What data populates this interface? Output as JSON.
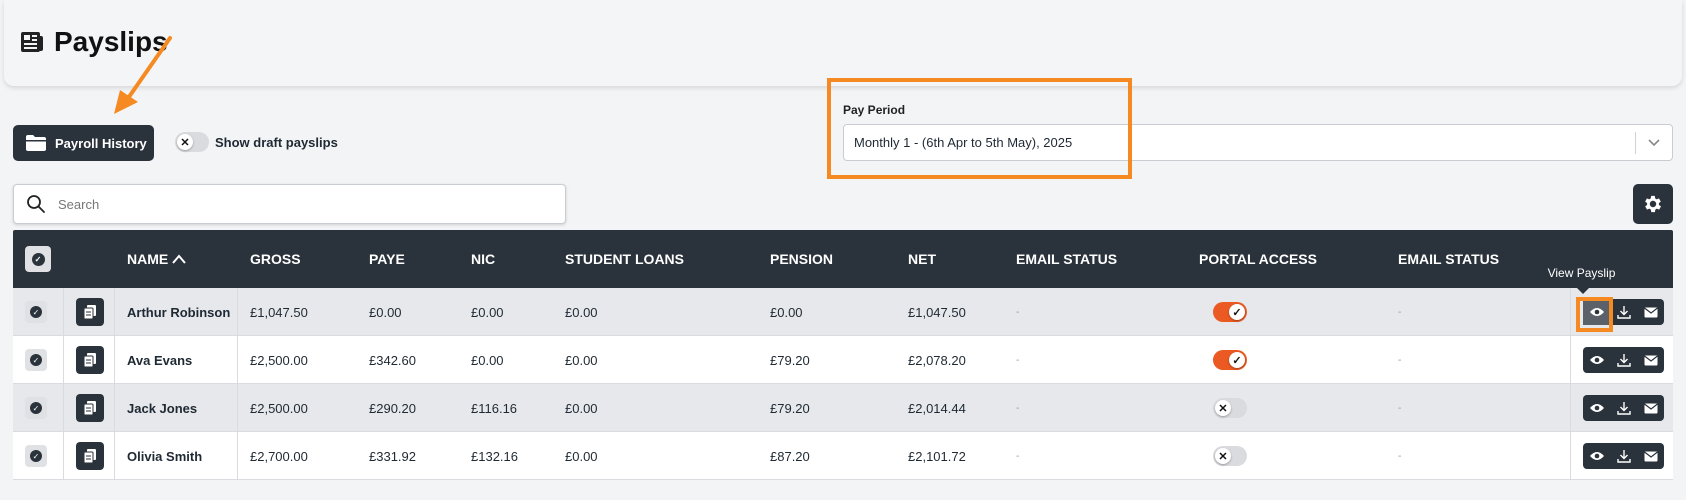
{
  "page": {
    "title": "Payslips"
  },
  "toolbar": {
    "history_label": "Payroll History",
    "draft_label": "Show draft payslips",
    "draft_enabled": false
  },
  "pay_period": {
    "label": "Pay Period",
    "value": "Monthly 1 - (6th Apr to 5th May), 2025"
  },
  "search": {
    "placeholder": "Search"
  },
  "table": {
    "columns": {
      "name": "NAME",
      "gross": "GROSS",
      "paye": "PAYE",
      "nic": "NIC",
      "student_loans": "STUDENT LOANS",
      "pension": "PENSION",
      "net": "NET",
      "email_status": "EMAIL STATUS",
      "portal_access": "PORTAL ACCESS",
      "email_status_2": "EMAIL STATUS"
    },
    "rows": [
      {
        "name": "Arthur Robinson",
        "gross": "£1,047.50",
        "paye": "£0.00",
        "nic": "£0.00",
        "student_loans": "£0.00",
        "pension": "£0.00",
        "net": "£1,047.50",
        "email_status": "-",
        "portal_access": true,
        "email_status_2": "-"
      },
      {
        "name": "Ava Evans",
        "gross": "£2,500.00",
        "paye": "£342.60",
        "nic": "£0.00",
        "student_loans": "£0.00",
        "pension": "£79.20",
        "net": "£2,078.20",
        "email_status": "-",
        "portal_access": true,
        "email_status_2": "-"
      },
      {
        "name": "Jack Jones",
        "gross": "£2,500.00",
        "paye": "£290.20",
        "nic": "£116.16",
        "student_loans": "£0.00",
        "pension": "£79.20",
        "net": "£2,014.44",
        "email_status": "-",
        "portal_access": false,
        "email_status_2": "-"
      },
      {
        "name": "Olivia Smith",
        "gross": "£2,700.00",
        "paye": "£331.92",
        "nic": "£132.16",
        "student_loans": "£0.00",
        "pension": "£87.20",
        "net": "£2,101.72",
        "email_status": "-",
        "portal_access": false,
        "email_status_2": "-"
      }
    ]
  },
  "tooltip": {
    "view_payslip": "View Payslip"
  },
  "icons": {
    "title": "payslip-icon",
    "history": "folder-icon",
    "search": "search-icon",
    "settings": "gear-icon",
    "view": "eye-icon",
    "download": "download-icon",
    "email": "envelope-icon",
    "row_doc": "documents-icon",
    "sort": "chevron-up-icon"
  },
  "colors": {
    "dark": "#2a323b",
    "accent_orange": "#ea5a22",
    "highlight": "#f58a22"
  }
}
